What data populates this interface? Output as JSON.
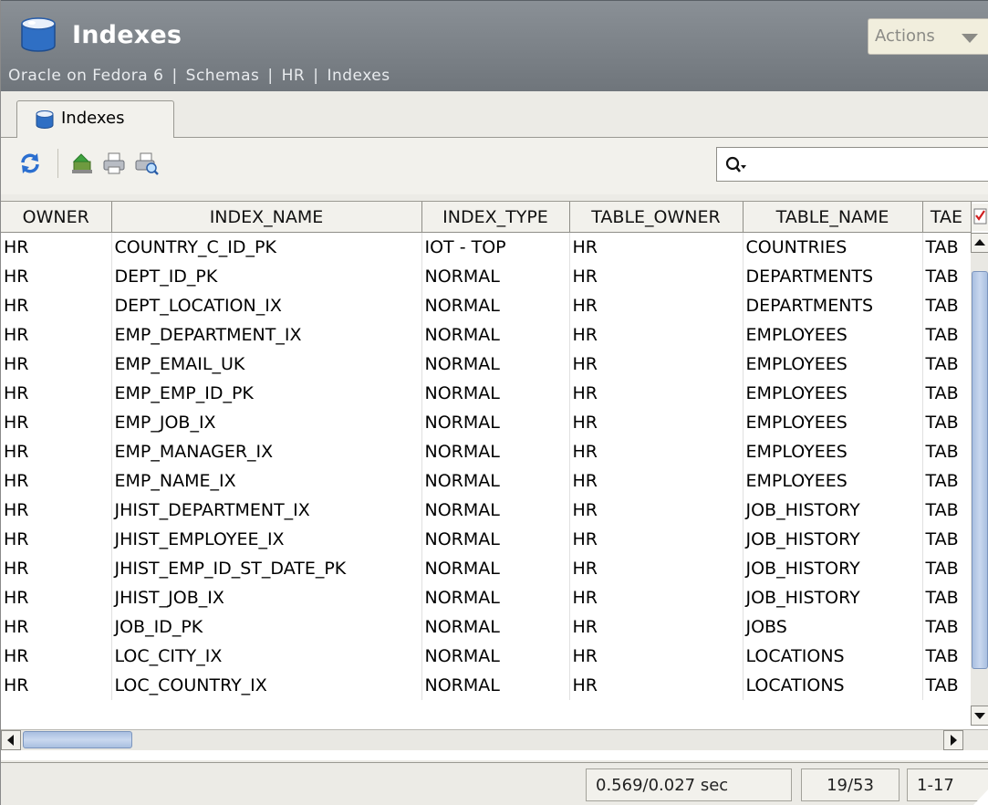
{
  "header": {
    "title": "Indexes",
    "actions_label": "Actions",
    "icon": "database-cylinder-icon",
    "breadcrumb": [
      "Oracle on Fedora 6",
      "Schemas",
      "HR",
      "Indexes"
    ]
  },
  "tabs": [
    {
      "label": "Indexes",
      "icon": "database-cylinder-icon",
      "active": true
    }
  ],
  "toolbar": {
    "buttons": [
      "refresh-icon",
      "export-icon",
      "print-icon",
      "print-preview-icon"
    ],
    "search_value": "",
    "search_icon": "search-icon"
  },
  "table": {
    "columns": [
      "OWNER",
      "INDEX_NAME",
      "INDEX_TYPE",
      "TABLE_OWNER",
      "TABLE_NAME",
      "TAE"
    ],
    "rows": [
      [
        "HR",
        "COUNTRY_C_ID_PK",
        "IOT - TOP",
        "HR",
        "COUNTRIES",
        "TAB"
      ],
      [
        "HR",
        "DEPT_ID_PK",
        "NORMAL",
        "HR",
        "DEPARTMENTS",
        "TAB"
      ],
      [
        "HR",
        "DEPT_LOCATION_IX",
        "NORMAL",
        "HR",
        "DEPARTMENTS",
        "TAB"
      ],
      [
        "HR",
        "EMP_DEPARTMENT_IX",
        "NORMAL",
        "HR",
        "EMPLOYEES",
        "TAB"
      ],
      [
        "HR",
        "EMP_EMAIL_UK",
        "NORMAL",
        "HR",
        "EMPLOYEES",
        "TAB"
      ],
      [
        "HR",
        "EMP_EMP_ID_PK",
        "NORMAL",
        "HR",
        "EMPLOYEES",
        "TAB"
      ],
      [
        "HR",
        "EMP_JOB_IX",
        "NORMAL",
        "HR",
        "EMPLOYEES",
        "TAB"
      ],
      [
        "HR",
        "EMP_MANAGER_IX",
        "NORMAL",
        "HR",
        "EMPLOYEES",
        "TAB"
      ],
      [
        "HR",
        "EMP_NAME_IX",
        "NORMAL",
        "HR",
        "EMPLOYEES",
        "TAB"
      ],
      [
        "HR",
        "JHIST_DEPARTMENT_IX",
        "NORMAL",
        "HR",
        "JOB_HISTORY",
        "TAB"
      ],
      [
        "HR",
        "JHIST_EMPLOYEE_IX",
        "NORMAL",
        "HR",
        "JOB_HISTORY",
        "TAB"
      ],
      [
        "HR",
        "JHIST_EMP_ID_ST_DATE_PK",
        "NORMAL",
        "HR",
        "JOB_HISTORY",
        "TAB"
      ],
      [
        "HR",
        "JHIST_JOB_IX",
        "NORMAL",
        "HR",
        "JOB_HISTORY",
        "TAB"
      ],
      [
        "HR",
        "JOB_ID_PK",
        "NORMAL",
        "HR",
        "JOBS",
        "TAB"
      ],
      [
        "HR",
        "LOC_CITY_IX",
        "NORMAL",
        "HR",
        "LOCATIONS",
        "TAB"
      ],
      [
        "HR",
        "LOC_COUNTRY_IX",
        "NORMAL",
        "HR",
        "LOCATIONS",
        "TAB"
      ]
    ]
  },
  "status": {
    "timing": "0.569/0.027 sec",
    "position": "19/53",
    "range": "1-17"
  },
  "colors": {
    "header_bg": "#7a8086",
    "title_text": "#ffffff",
    "scroll_thumb": "#b8cbe8"
  }
}
